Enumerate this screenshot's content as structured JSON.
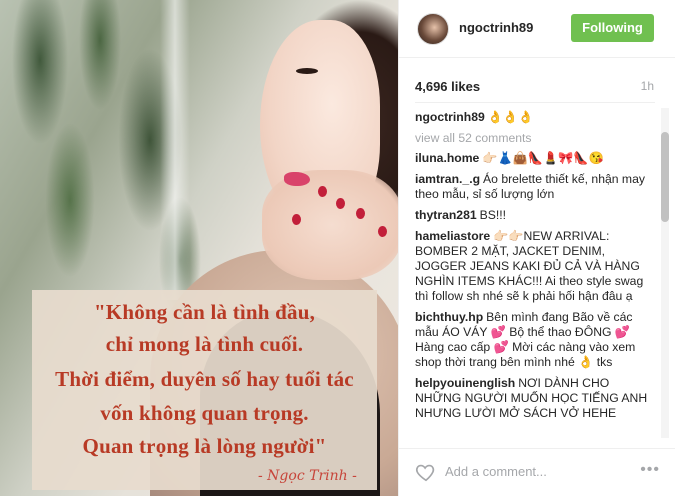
{
  "post": {
    "quote_lines": [
      "\"Không cần là tình đầu,",
      "chỉ mong là tình cuối.",
      "Thời điểm, duyên số hay tuổi tác",
      "vốn không quan trọng.",
      "Quan trọng là lòng người\""
    ],
    "signature": "- Ngọc Trinh -"
  },
  "header": {
    "username": "ngoctrinh89",
    "follow_label": "Following"
  },
  "stats": {
    "likes": "4,696 likes",
    "time": "1h"
  },
  "caption": {
    "user": "ngoctrinh89",
    "text": "👌👌👌"
  },
  "view_all": "view all 52 comments",
  "comments": [
    {
      "user": "iluna.home",
      "text": "👉🏻👗👜👠💄🎀👠😘"
    },
    {
      "user": "iamtran._.g",
      "text": "Áo brelette thiết kế, nhận may theo mẫu, sỉ số lượng lớn"
    },
    {
      "user": "thytran281",
      "text": "BS!!!"
    },
    {
      "user": "hameliastore",
      "text": "👉🏻👉🏻NEW ARRIVAL: BOMBER 2 MẶT, JACKET DENIM, JOGGER JEANS KAKI ĐỦ CẢ VÀ HÀNG NGHÌN ITEMS KHÁC!!! Ai theo style swag thì follow sh nhé sẽ k phải hối hận đâu ạ"
    },
    {
      "user": "bichthuy.hp",
      "text": "Bên mình đang Bão về các mẫu ÁO VÁY 💕 Bộ thể thao ĐÔNG 💕 Hàng cao cấp 💕 Mời các nàng vào xem shop thời trang bên mình nhé 👌 tks"
    },
    {
      "user": "helpyouinenglish",
      "text": "NƠI DÀNH CHO NHỮNG NGƯỜI MUỐN HỌC TIẾNG ANH NHƯNG LƯỜI MỞ SÁCH VỞ HEHE"
    }
  ],
  "footer": {
    "comment_placeholder": "Add a comment...",
    "more_label": "•••"
  },
  "colors": {
    "follow_button": "#70c050",
    "quote_text": "#b83a25",
    "muted_text": "#a5a7aa"
  },
  "icons": {
    "like": "heart-icon",
    "options": "more-options-icon"
  }
}
